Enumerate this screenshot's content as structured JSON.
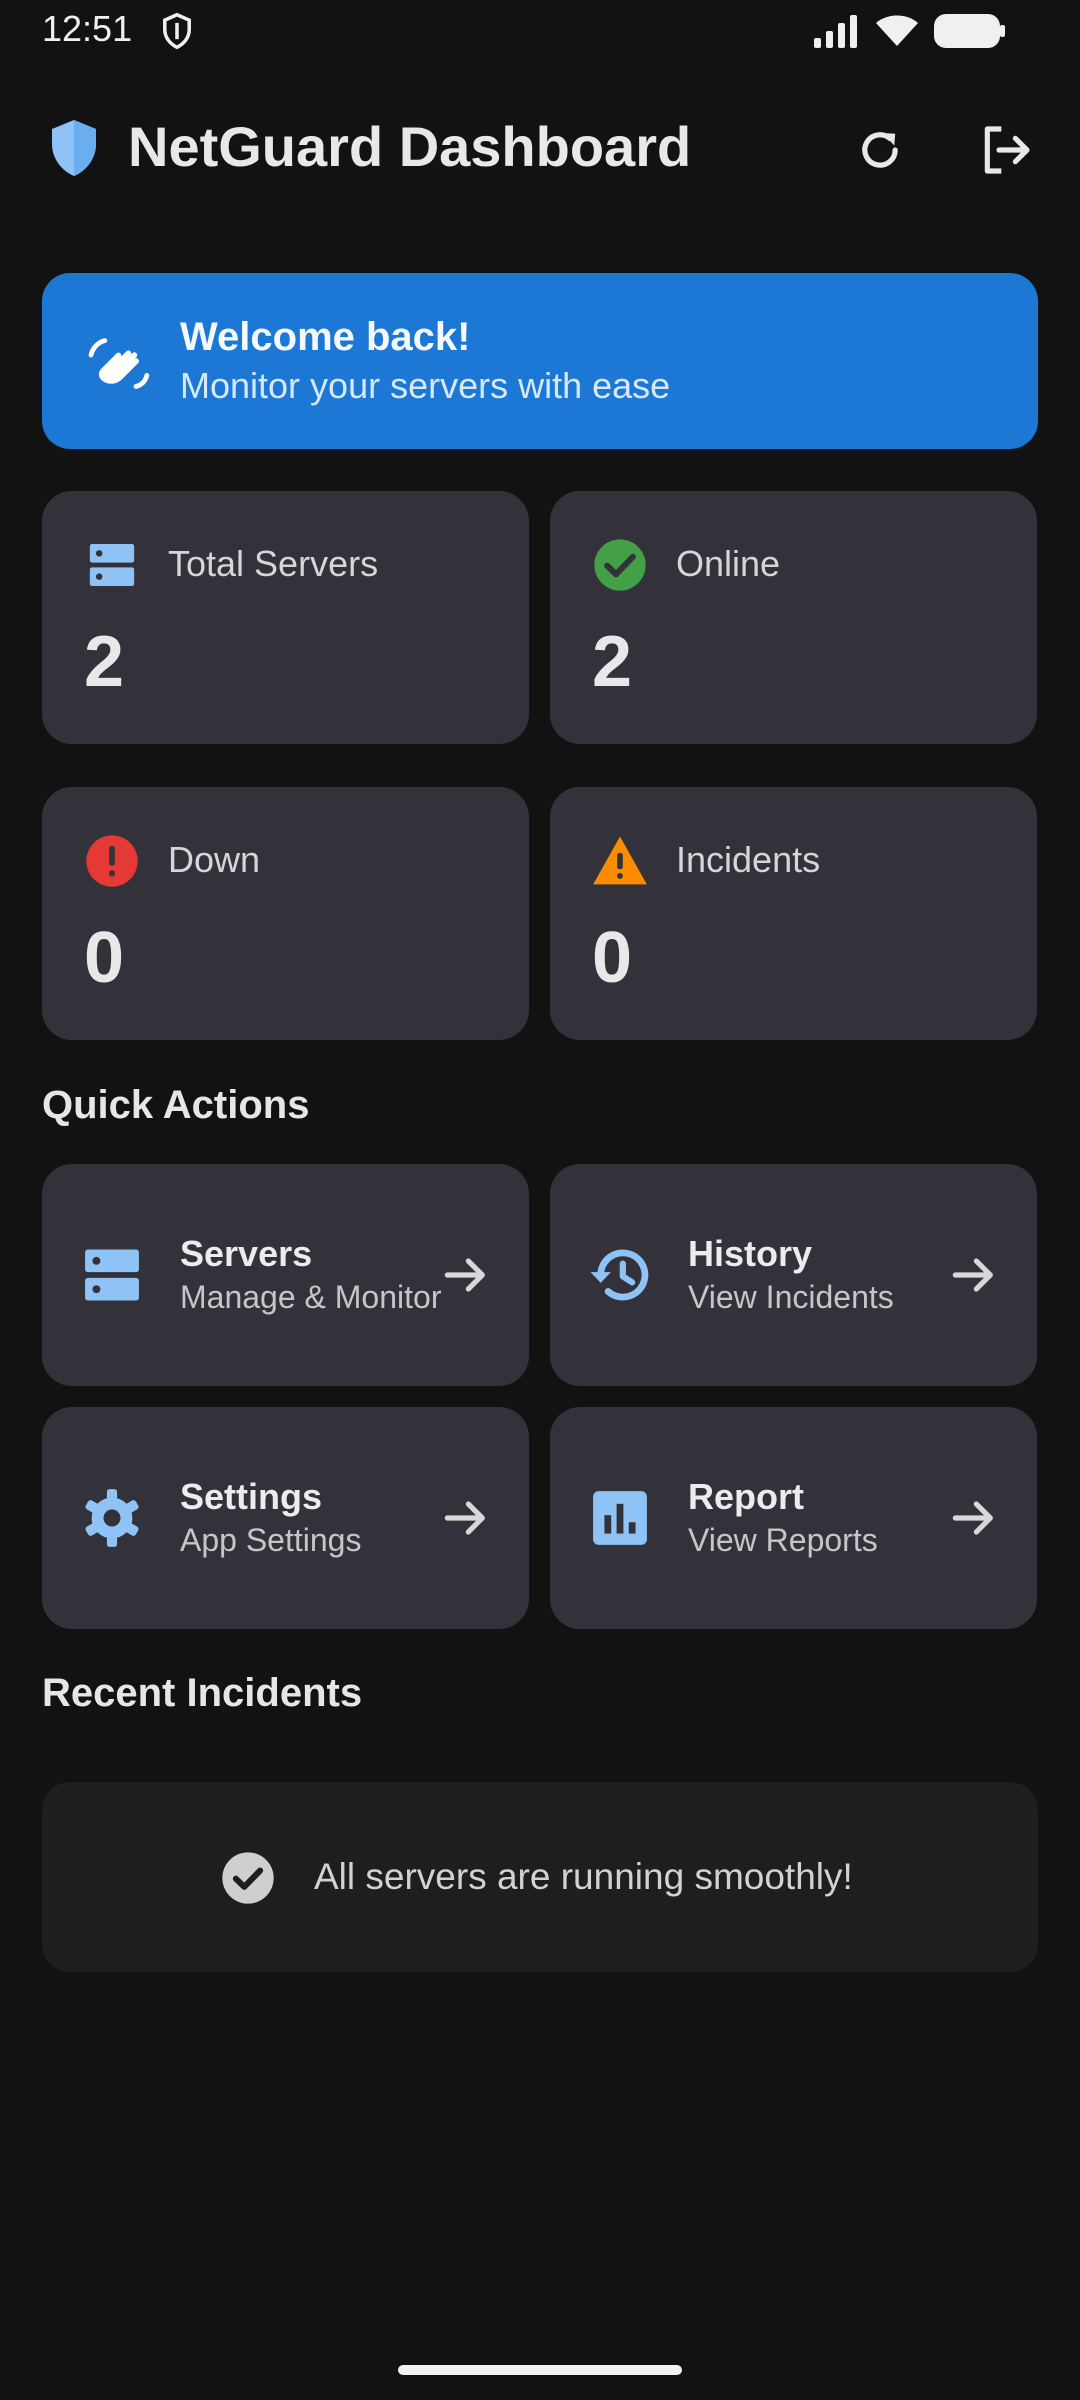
{
  "status_bar": {
    "time": "12:51"
  },
  "app_bar": {
    "title": "NetGuard Dashboard"
  },
  "welcome": {
    "title": "Welcome back!",
    "subtitle": "Monitor your servers with ease"
  },
  "stats": [
    {
      "label": "Total Servers",
      "value": "2",
      "icon": "server-icon",
      "color": "#8fc3f5"
    },
    {
      "label": "Online",
      "value": "2",
      "icon": "check-circle-icon",
      "color": "#43a047"
    },
    {
      "label": "Down",
      "value": "0",
      "icon": "error-icon",
      "color": "#e53935"
    },
    {
      "label": "Incidents",
      "value": "0",
      "icon": "warning-icon",
      "color": "#fb8c00"
    }
  ],
  "quick_actions": {
    "title": "Quick Actions",
    "items": [
      {
        "title": "Servers",
        "subtitle": "Manage & Monitor",
        "icon": "server-icon"
      },
      {
        "title": "History",
        "subtitle": "View Incidents",
        "icon": "history-icon"
      },
      {
        "title": "Settings",
        "subtitle": "App Settings",
        "icon": "gear-icon"
      },
      {
        "title": "Report",
        "subtitle": "View Reports",
        "icon": "bar-chart-icon"
      }
    ]
  },
  "recent_incidents": {
    "title": "Recent Incidents",
    "empty_message": "All servers are running smoothly!"
  },
  "colors": {
    "accent": "#1c78d4",
    "icon_blue": "#8fc3f5",
    "card": "#33323a",
    "background": "#121212"
  }
}
